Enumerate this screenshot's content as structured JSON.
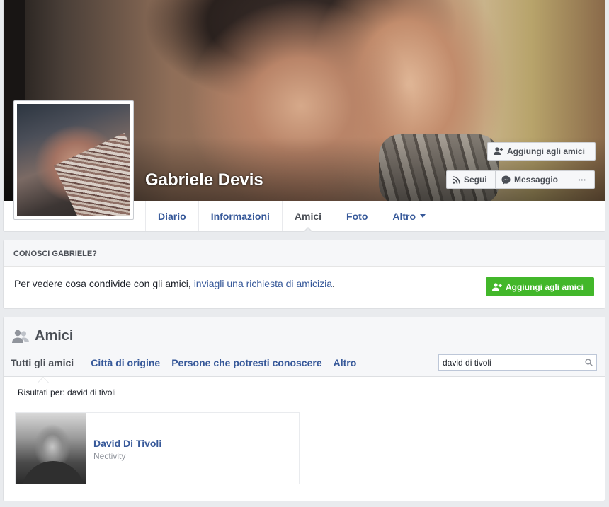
{
  "profile": {
    "name": "Gabriele Devis",
    "actions": {
      "add_friend": "Aggiungi agli amici",
      "follow": "Segui",
      "message": "Messaggio",
      "more": "···"
    },
    "nav": [
      {
        "label": "Diario"
      },
      {
        "label": "Informazioni"
      },
      {
        "label": "Amici"
      },
      {
        "label": "Foto"
      },
      {
        "label": "Altro"
      }
    ]
  },
  "know": {
    "heading": "CONOSCI GABRIELE?",
    "text": "Per vedere cosa condivide con gli amici, ",
    "link": "inviagli una richiesta di amicizia",
    "text_end": ".",
    "button": "Aggiungi agli amici"
  },
  "friends": {
    "title": "Amici",
    "tabs": [
      {
        "label": "Tutti gli amici"
      },
      {
        "label": "Città di origine"
      },
      {
        "label": "Persone che potresti conoscere"
      },
      {
        "label": "Altro"
      }
    ],
    "search": {
      "value": "david di tivoli"
    },
    "results_label": "Risultati per: david di tivoli",
    "items": [
      {
        "name": "David Di Tivoli",
        "subtitle": "Nectivity"
      }
    ]
  },
  "colors": {
    "link_blue": "#365899",
    "green": "#42b72a",
    "page_bg": "#e9ebee"
  }
}
